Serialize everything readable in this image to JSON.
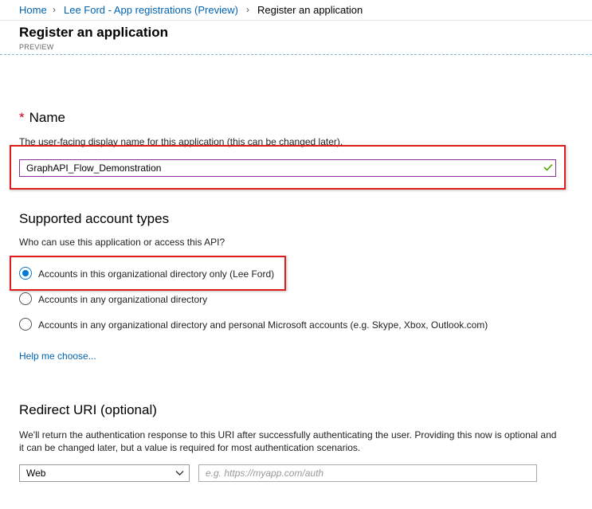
{
  "breadcrumb": {
    "home": "Home",
    "sep1": "›",
    "parent": "Lee Ford - App registrations (Preview)",
    "sep2": "›",
    "current": "Register an application"
  },
  "header": {
    "title": "Register an application",
    "subtitle": "PREVIEW"
  },
  "name_section": {
    "required_marker": "*",
    "heading": "Name",
    "description": "The user-facing display name for this application (this can be changed later).",
    "value": "GraphAPI_Flow_Demonstration"
  },
  "account_types": {
    "heading": "Supported account types",
    "question": "Who can use this application or access this API?",
    "options": [
      {
        "label": "Accounts in this organizational directory only (Lee Ford)",
        "selected": true
      },
      {
        "label": "Accounts in any organizational directory",
        "selected": false
      },
      {
        "label": "Accounts in any organizational directory and personal Microsoft accounts (e.g. Skype, Xbox, Outlook.com)",
        "selected": false
      }
    ],
    "help_link": "Help me choose..."
  },
  "redirect": {
    "heading": "Redirect URI (optional)",
    "description_line1": "We'll return the authentication response to this URI after successfully authenticating the user. Providing this now is optional and",
    "description_line2": "it can be changed later, but a value is required for most authentication scenarios.",
    "platform_selected": "Web",
    "uri_placeholder": "e.g. https://myapp.com/auth"
  },
  "colors": {
    "link": "#0063b1",
    "required": "#d0021b",
    "input_border_focus": "#8a2f99",
    "radio_selected": "#0078d4",
    "highlight_box": "#e01b1b",
    "valid_check": "#57a300"
  },
  "icons": {
    "valid": "checkmark-icon",
    "dropdown": "chevron-down-icon"
  }
}
